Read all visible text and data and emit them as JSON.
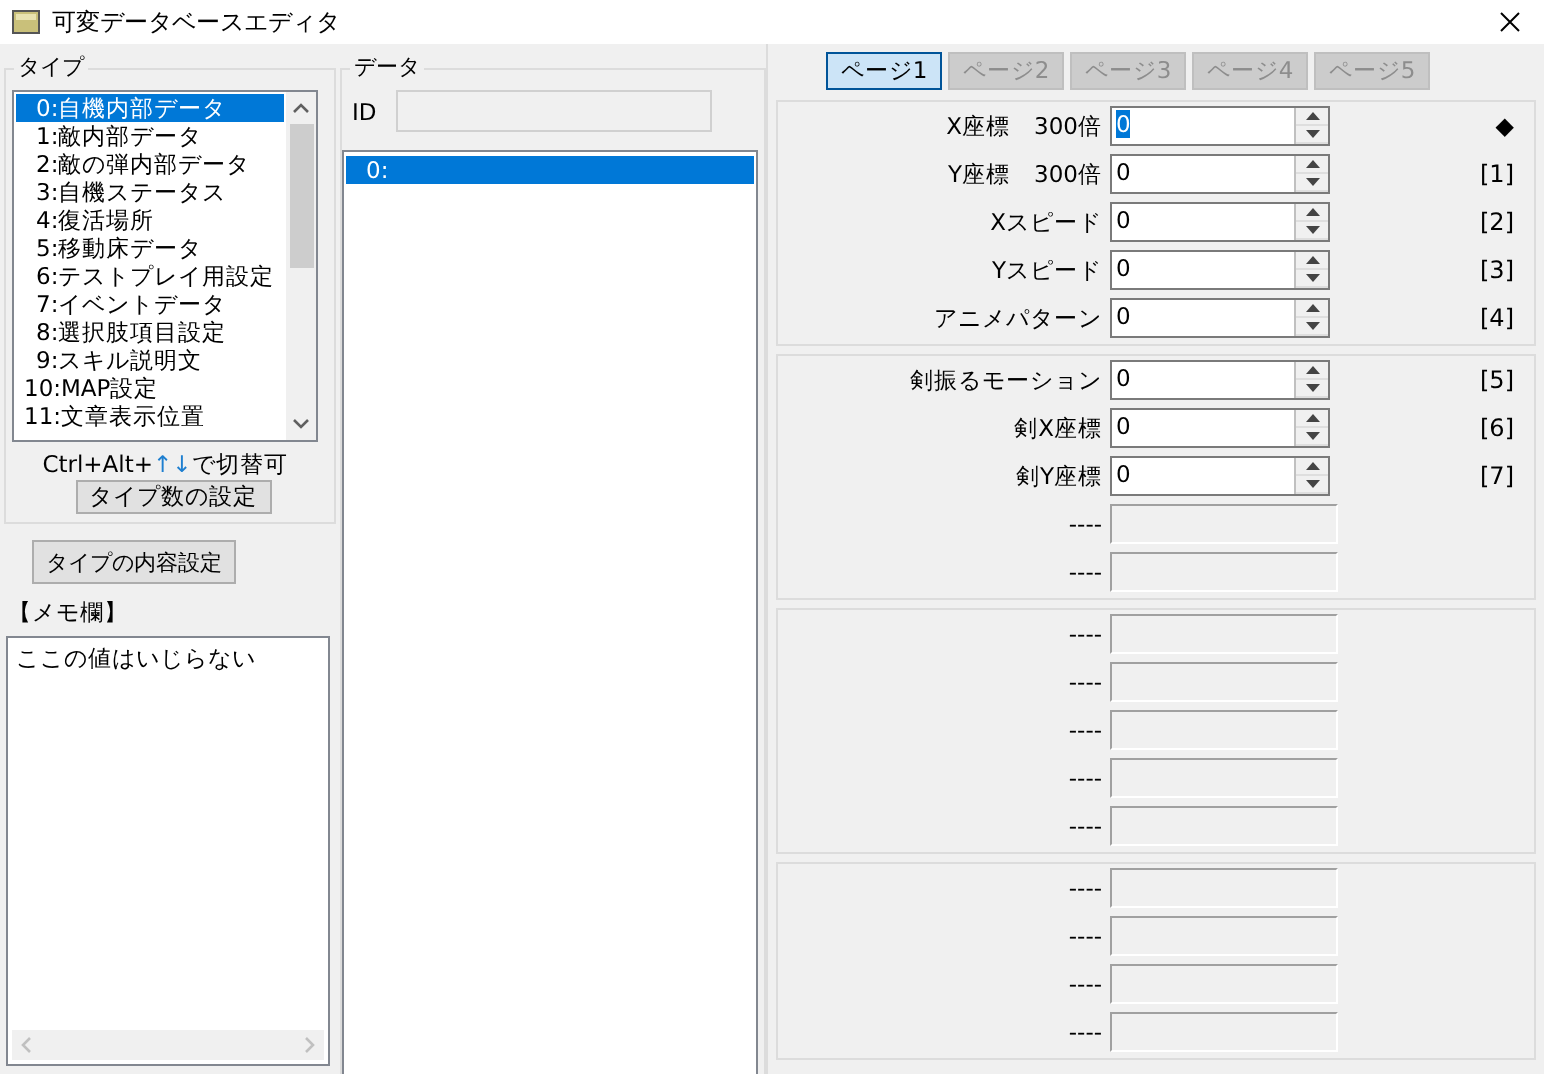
{
  "window": {
    "title": "可変データベースエディタ"
  },
  "type_group": {
    "title": "タイプ",
    "items": [
      {
        "label": "0:自機内部データ",
        "selected": true
      },
      {
        "label": "1:敵内部データ",
        "selected": false
      },
      {
        "label": "2:敵の弾内部データ",
        "selected": false
      },
      {
        "label": "3:自機ステータス",
        "selected": false
      },
      {
        "label": "4:復活場所",
        "selected": false
      },
      {
        "label": "5:移動床データ",
        "selected": false
      },
      {
        "label": "6:テストプレイ用設定",
        "selected": false
      },
      {
        "label": "7:イベントデータ",
        "selected": false
      },
      {
        "label": "8:選択肢項目設定",
        "selected": false
      },
      {
        "label": "9:スキル説明文",
        "selected": false
      },
      {
        "label": "10:MAP設定",
        "selected": false
      },
      {
        "label": "11:文章表示位置",
        "selected": false
      }
    ],
    "hint": {
      "before": "Ctrl+Alt+",
      "arrows": "↑↓",
      "after": "で切替可"
    },
    "count_button": "タイプ数の設定"
  },
  "content_button": "タイプの内容設定",
  "memo": {
    "label": "【メモ欄】",
    "text": "ここの値はいじらない"
  },
  "data_group": {
    "title": "データ",
    "id_label": "ID",
    "items": [
      {
        "label": "0:",
        "selected": true
      }
    ]
  },
  "tabs": [
    {
      "label": "ページ1",
      "selected": true,
      "disabled": false
    },
    {
      "label": "ページ2",
      "selected": false,
      "disabled": true
    },
    {
      "label": "ページ3",
      "selected": false,
      "disabled": true
    },
    {
      "label": "ページ4",
      "selected": false,
      "disabled": true
    },
    {
      "label": "ページ5",
      "selected": false,
      "disabled": true
    }
  ],
  "sections": [
    {
      "rows": [
        {
          "kind": "spin",
          "label": "X座標　300倍",
          "value": "0",
          "focused": true,
          "marker": "◆"
        },
        {
          "kind": "spin",
          "label": "Y座標　300倍",
          "value": "0",
          "focused": false,
          "marker": "[1]"
        },
        {
          "kind": "spin",
          "label": "Xスピード",
          "value": "0",
          "focused": false,
          "marker": "[2]"
        },
        {
          "kind": "spin",
          "label": "Yスピード",
          "value": "0",
          "focused": false,
          "marker": "[3]"
        },
        {
          "kind": "spin",
          "label": "アニメパターン",
          "value": "0",
          "focused": false,
          "marker": "[4]"
        }
      ]
    },
    {
      "rows": [
        {
          "kind": "spin",
          "label": "剣振るモーション",
          "value": "0",
          "focused": false,
          "marker": "[5]"
        },
        {
          "kind": "spin",
          "label": "剣X座標",
          "value": "0",
          "focused": false,
          "marker": "[6]"
        },
        {
          "kind": "spin",
          "label": "剣Y座標",
          "value": "0",
          "focused": false,
          "marker": "[7]"
        },
        {
          "kind": "empty",
          "label": "----"
        },
        {
          "kind": "empty",
          "label": "----"
        }
      ]
    },
    {
      "rows": [
        {
          "kind": "empty",
          "label": "----"
        },
        {
          "kind": "empty",
          "label": "----"
        },
        {
          "kind": "empty",
          "label": "----"
        },
        {
          "kind": "empty",
          "label": "----"
        },
        {
          "kind": "empty",
          "label": "----"
        }
      ]
    },
    {
      "rows": [
        {
          "kind": "empty",
          "label": "----"
        },
        {
          "kind": "empty",
          "label": "----"
        },
        {
          "kind": "empty",
          "label": "----"
        },
        {
          "kind": "empty",
          "label": "----"
        }
      ]
    }
  ]
}
